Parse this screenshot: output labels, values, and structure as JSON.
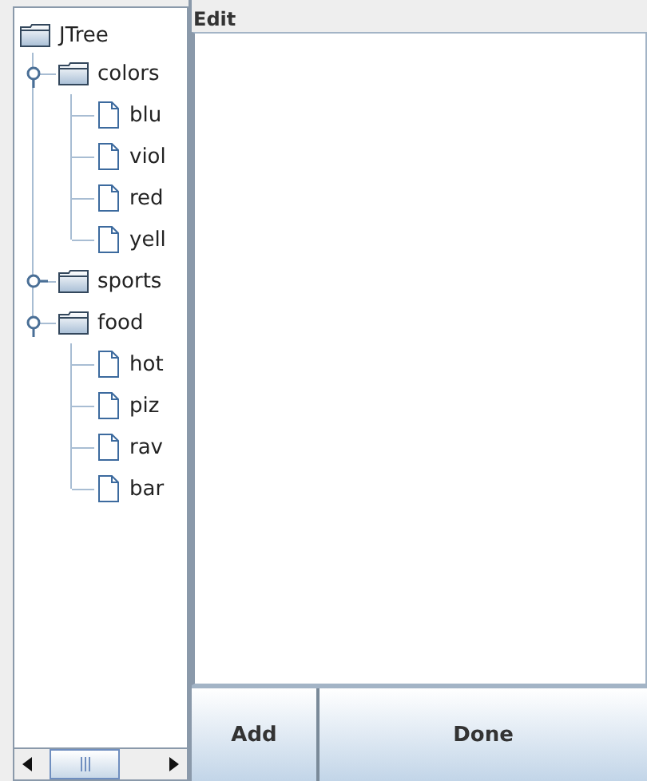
{
  "tree": {
    "label": "JTree",
    "kind": "folder",
    "children": [
      {
        "label": "colors",
        "kind": "folder",
        "expanded": true,
        "children": [
          {
            "label": "blu",
            "kind": "leaf"
          },
          {
            "label": "viol",
            "kind": "leaf"
          },
          {
            "label": "red",
            "kind": "leaf"
          },
          {
            "label": "yell",
            "kind": "leaf"
          }
        ]
      },
      {
        "label": "sports",
        "kind": "folder",
        "expanded": false
      },
      {
        "label": "food",
        "kind": "folder",
        "expanded": true,
        "children": [
          {
            "label": "hot",
            "kind": "leaf"
          },
          {
            "label": "piz",
            "kind": "leaf"
          },
          {
            "label": "rav",
            "kind": "leaf"
          },
          {
            "label": "bar",
            "kind": "leaf"
          }
        ]
      }
    ]
  },
  "editor": {
    "title": "Edit"
  },
  "buttons": [
    "Add",
    "Done"
  ]
}
